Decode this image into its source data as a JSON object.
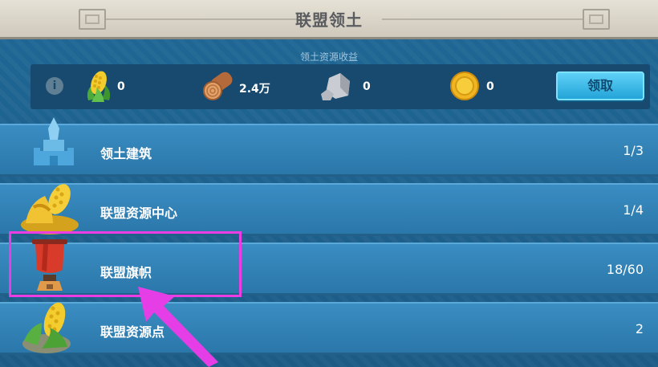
{
  "header": {
    "title": "联盟领土"
  },
  "income": {
    "title": "领土资源收益",
    "info_icon": "info-icon",
    "resources": [
      {
        "name": "corn",
        "icon": "corn-icon",
        "value": "0"
      },
      {
        "name": "wood",
        "icon": "wood-log-icon",
        "value": "2.4万"
      },
      {
        "name": "stone",
        "icon": "stone-icon",
        "value": "0"
      },
      {
        "name": "gold",
        "icon": "gold-coin-icon",
        "value": "0"
      }
    ],
    "claim_label": "领取"
  },
  "rows": [
    {
      "label": "领土建筑",
      "count": "1/3",
      "icon": "tower-icon"
    },
    {
      "label": "联盟资源中心",
      "count": "1/4",
      "icon": "resource-center-icon"
    },
    {
      "label": "联盟旗帜",
      "count": "18/60",
      "icon": "banner-flag-icon"
    },
    {
      "label": "联盟资源点",
      "count": "2",
      "icon": "corn-field-icon"
    }
  ],
  "colors": {
    "header_bg": "#ddd8cc",
    "panel_bg": "#1c5f8e",
    "row_bg": "#3a8dc2",
    "claim_button": "#3bbbe8",
    "highlight": "#ea3ee4"
  }
}
